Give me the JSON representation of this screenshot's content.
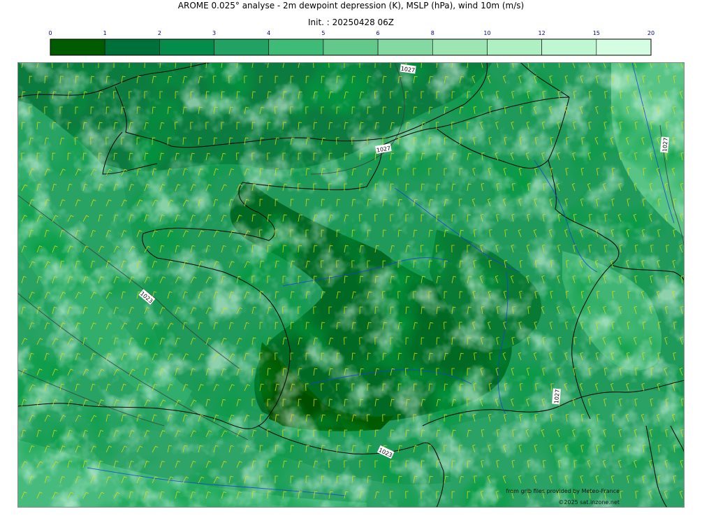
{
  "header": {
    "title": "AROME 0.025° analyse - 2m dewpoint depression (K), MSLP (hPa), wind 10m (m/s)",
    "init": "Init. : 20250428 06Z"
  },
  "colorbar": {
    "levels": [
      "0",
      "1",
      "2",
      "3",
      "4",
      "5",
      "6",
      "8",
      "10",
      "12",
      "15",
      "20"
    ],
    "colors": [
      "#005a00",
      "#00703a",
      "#068c4a",
      "#22a262",
      "#3fbb78",
      "#62c98a",
      "#84d8a2",
      "#9de6b4",
      "#aef0c2",
      "#bff7d2",
      "#d4fde2"
    ]
  },
  "map": {
    "isobar_labels": [
      "1027",
      "1027",
      "1027",
      "1023",
      "1027",
      "1023"
    ],
    "credits": {
      "source": "from grib files provided by Meteo-France",
      "copyright": "©2025 sat.inzone.net"
    }
  },
  "colors": {
    "coast": "#000000",
    "rivers": "#1a3fd4",
    "wind_barbs": "#e8e000",
    "isobars": "#3a3a3a"
  }
}
